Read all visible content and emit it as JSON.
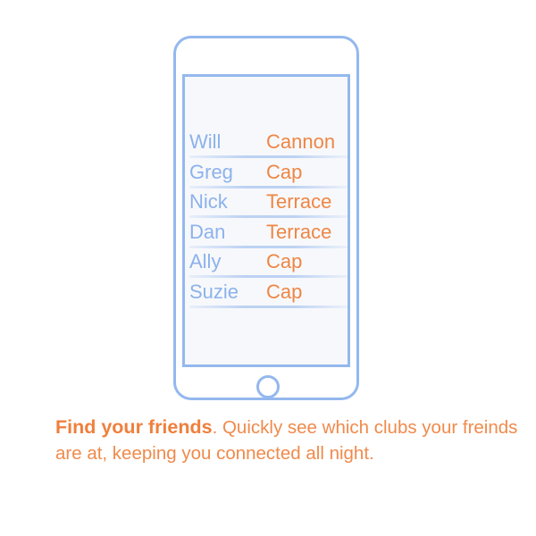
{
  "colors": {
    "phone_outline": "#94B8EE",
    "name_text": "#8CB2EC",
    "club_text": "#EE8645",
    "caption_text": "#F08A4B"
  },
  "friends": [
    {
      "name": "Will",
      "club": "Cannon"
    },
    {
      "name": "Greg",
      "club": "Cap"
    },
    {
      "name": "Nick",
      "club": "Terrace"
    },
    {
      "name": "Dan",
      "club": "Terrace"
    },
    {
      "name": "Ally",
      "club": "Cap"
    },
    {
      "name": "Suzie",
      "club": "Cap"
    }
  ],
  "caption": {
    "title": "Find your friends",
    "body": ". Quickly see which clubs your freinds are at, keeping you connected all night."
  }
}
